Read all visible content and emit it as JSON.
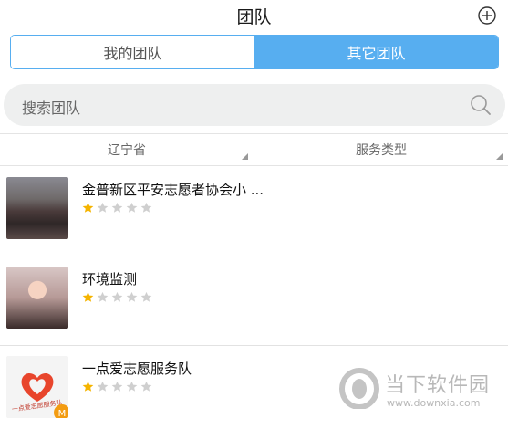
{
  "header": {
    "title": "团队",
    "add_icon": "plus-circle-icon"
  },
  "segment": {
    "tabs": [
      {
        "label": "我的团队",
        "active": false
      },
      {
        "label": "其它团队",
        "active": true
      }
    ],
    "accent": "#57aef0"
  },
  "search": {
    "placeholder": "搜索团队",
    "icon": "search-icon"
  },
  "filters": [
    {
      "label": "辽宁省"
    },
    {
      "label": "服务类型"
    }
  ],
  "teams": [
    {
      "name": "金普新区平安志愿者协会小 ...",
      "rating": 1,
      "max_rating": 5
    },
    {
      "name": "环境监测",
      "rating": 1,
      "max_rating": 5
    },
    {
      "name": "一点爱志愿服务队",
      "rating": 1,
      "max_rating": 5,
      "logo_text": "一点爱志愿服务队"
    }
  ],
  "colors": {
    "star_on": "#f5b400",
    "star_off": "#cfcfcf"
  },
  "watermark": {
    "brand": "当下软件园",
    "url": "www.downxia.com"
  }
}
